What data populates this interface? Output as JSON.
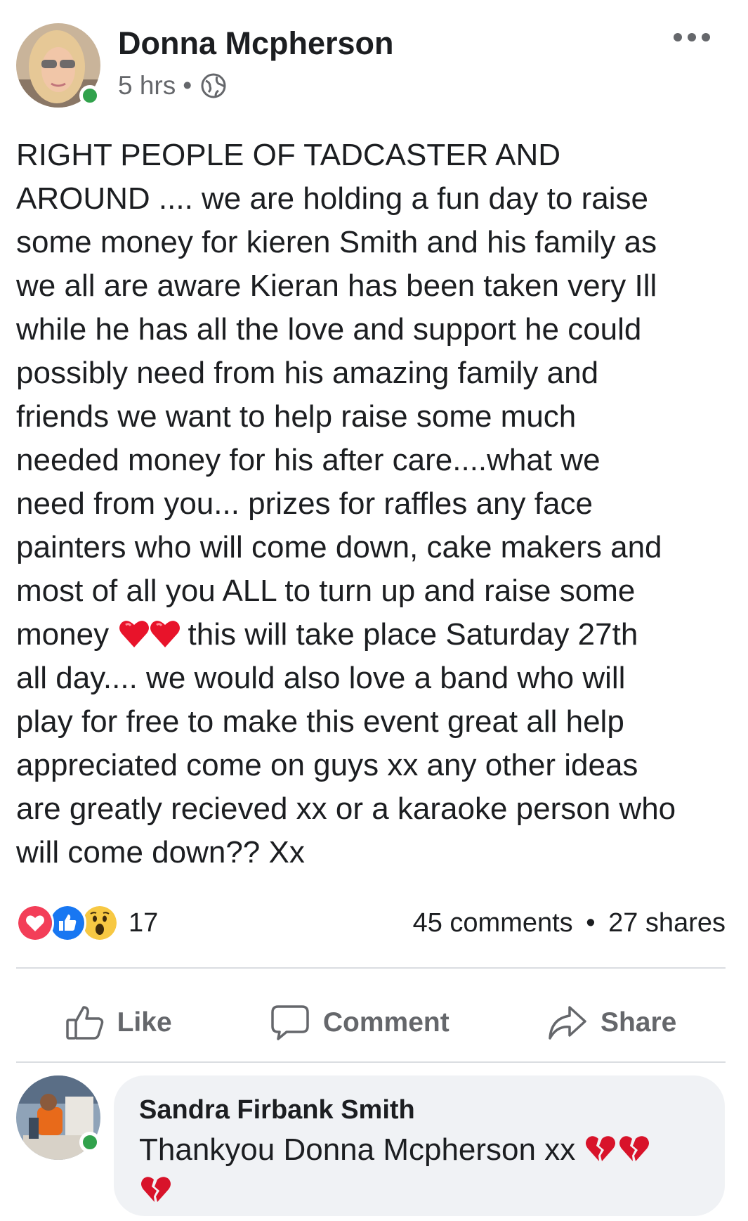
{
  "post": {
    "author": "Donna Mcpherson",
    "time": "5 hrs",
    "separator": "•",
    "privacy_icon": "globe-icon",
    "text_before_hearts": "RIGHT PEOPLE OF TADCASTER AND\nAROUND .... we are holding a fun day to raise\nsome money for kieren Smith and his family as\nwe all are aware Kieran has been taken very Ill\nwhile he has all the love and support he could\npossibly need from his amazing family and\nfriends we want to help raise some much\nneeded money for his after care....what we\nneed from you... prizes for raffles any face\npainters who will come down, cake makers and\nmost of all you ALL to turn up and raise some\nmoney ",
    "text_after_hearts": " this will take place Saturday 27th\nall day.... we would also love a band who will\nplay for free to make this event great all help\nappreciated come on guys xx any other ideas\nare greatly recieved xx or a karaoke person who\nwill come down?? Xx",
    "reactions": [
      "love",
      "like",
      "wow"
    ],
    "reaction_count": "17",
    "comments_count": "45 comments",
    "shares_count": "27 shares"
  },
  "actions": {
    "like": "Like",
    "comment": "Comment",
    "share": "Share"
  },
  "comment": {
    "author": "Sandra Firbank Smith",
    "text": "Thankyou Donna Mcpherson xx "
  },
  "colors": {
    "text": "#1c1e21",
    "secondary": "#65676b",
    "online": "#31a24c",
    "like_blue": "#1877f2",
    "love_red": "#f33e58",
    "bubble_bg": "#f0f2f5"
  }
}
